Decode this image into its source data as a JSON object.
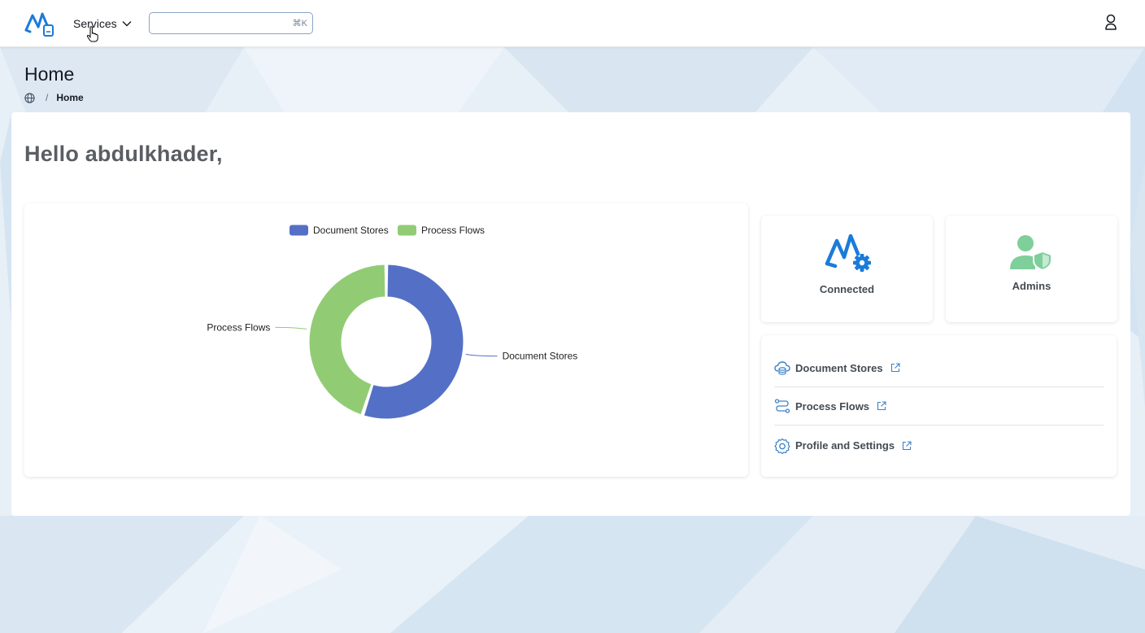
{
  "header": {
    "services_label": "Services",
    "search_placeholder": "",
    "search_shortcut": "⌘K",
    "icons": {
      "logo": "brand-logo-icon",
      "services_chevron": "chevron-down-icon",
      "user": "user-icon"
    }
  },
  "page": {
    "title": "Home",
    "breadcrumb": {
      "current": "Home",
      "separator": "/",
      "root_icon": "globe-icon"
    },
    "greeting": "Hello abdulkhader,"
  },
  "chart_data": {
    "type": "pie",
    "donut": true,
    "title": "",
    "legend_position": "top-center",
    "categories": [
      "Document Stores",
      "Process Flows"
    ],
    "values": [
      55,
      45
    ],
    "colors": [
      "#5470c6",
      "#91cc75"
    ]
  },
  "tiles": [
    {
      "label": "Connected",
      "icon": "connected-gear-icon",
      "color": "#1b7bd8"
    },
    {
      "label": "Admins",
      "icon": "admin-shield-icon",
      "color": "#7ecf9a"
    }
  ],
  "links": [
    {
      "label": "Document Stores",
      "icon": "cloud-storage-icon"
    },
    {
      "label": "Process Flows",
      "icon": "flow-icon"
    },
    {
      "label": "Profile and Settings",
      "icon": "gear-icon"
    }
  ],
  "colors": {
    "accent": "#0972d3",
    "link_icon": "#3b83c8"
  }
}
